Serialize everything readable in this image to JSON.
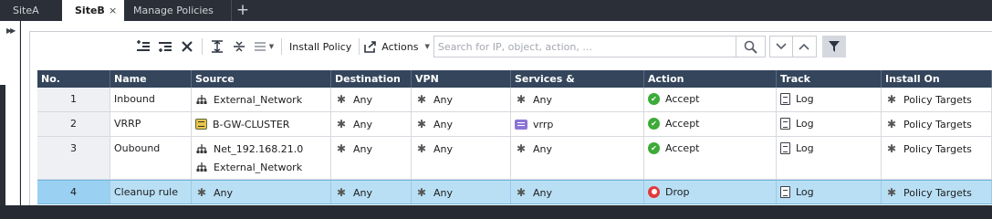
{
  "tabs": [
    {
      "label": "SiteA",
      "active": false
    },
    {
      "label": "SiteB",
      "active": true,
      "close": "×"
    },
    {
      "label": "Manage Policies",
      "active": false
    }
  ],
  "tab_add": "+",
  "toolbar": {
    "install_policy_label": "Install Policy",
    "actions_label": "Actions",
    "search_placeholder": "Search for IP, object, action, ..."
  },
  "table": {
    "columns": [
      "No.",
      "Name",
      "Source",
      "Destination",
      "VPN",
      "Services & Applications",
      "Action",
      "Track",
      "Install On"
    ],
    "rows": [
      {
        "no": "1",
        "name": "Inbound",
        "source": [
          {
            "icon": "network-icon",
            "text": "External_Network"
          }
        ],
        "destination": "Any",
        "vpn": "Any",
        "services": {
          "icon": "any-icon",
          "text": "Any"
        },
        "action": {
          "icon": "accept-icon",
          "text": "Accept"
        },
        "track": "Log",
        "install_on": "Policy Targets"
      },
      {
        "no": "2",
        "name": "VRRP",
        "source": [
          {
            "icon": "cluster-icon",
            "text": "B-GW-CLUSTER"
          }
        ],
        "destination": "Any",
        "vpn": "Any",
        "services": {
          "icon": "service-icon",
          "text": "vrrp"
        },
        "action": {
          "icon": "accept-icon",
          "text": "Accept"
        },
        "track": "Log",
        "install_on": "Policy Targets"
      },
      {
        "no": "3",
        "name": "Oubound",
        "source": [
          {
            "icon": "network-icon",
            "text": "Net_192.168.21.0"
          },
          {
            "icon": "network-icon",
            "text": "External_Network"
          }
        ],
        "destination": "Any",
        "vpn": "Any",
        "services": {
          "icon": "any-icon",
          "text": "Any"
        },
        "action": {
          "icon": "accept-icon",
          "text": "Accept"
        },
        "track": "Log",
        "install_on": "Policy Targets"
      },
      {
        "no": "4",
        "name": "Cleanup rule",
        "source": [
          {
            "icon": "any-icon",
            "text": "Any"
          }
        ],
        "destination": "Any",
        "vpn": "Any",
        "services": {
          "icon": "any-icon",
          "text": "Any"
        },
        "action": {
          "icon": "drop-icon",
          "text": "Drop"
        },
        "track": "Log",
        "install_on": "Policy Targets",
        "selected": true
      }
    ]
  },
  "colors": {
    "header_bg": "#34455c",
    "selected_row": "#b9dff5",
    "accept": "#3cab38",
    "drop": "#e23a3a",
    "tabbar": "#2b2f37"
  }
}
